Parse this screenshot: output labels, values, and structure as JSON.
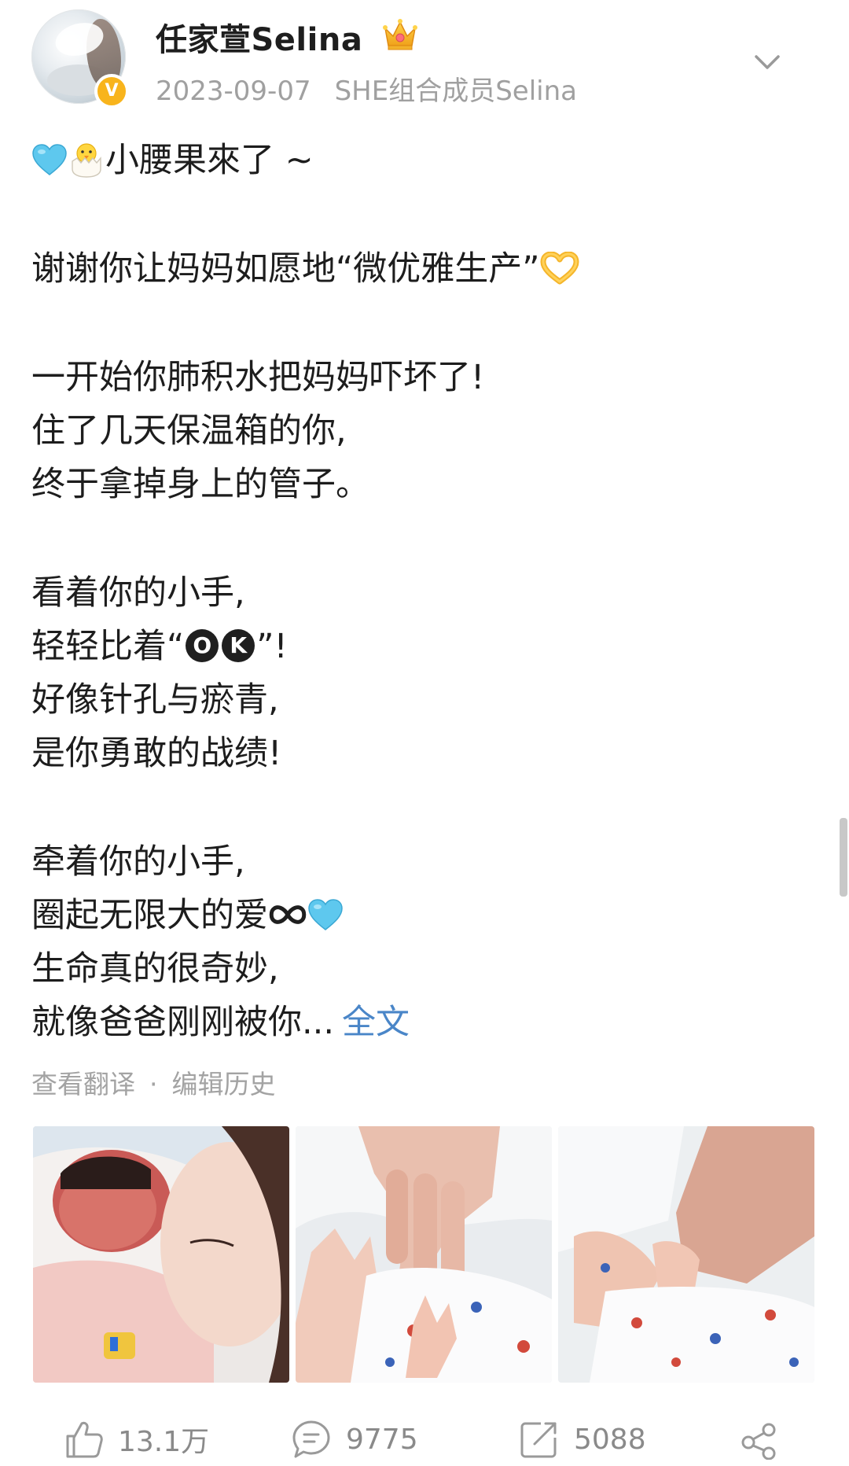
{
  "header": {
    "username": "任家萱Selina",
    "date": "2023-09-07",
    "source": "SHE组合成员Selina",
    "verified_mark": "V"
  },
  "post": {
    "line1_text": "小腰果來了 ~",
    "line2_text": "谢谢你让妈妈如愿地“微优雅生产”",
    "line3": "一开始你肺积水把妈妈吓坏了!",
    "line4": "住了几天保温箱的你,",
    "line5": "终于拿掉身上的管子。",
    "line6": "看着你的小手,",
    "line7_before": "轻轻比着“",
    "ok_letter_1": "O",
    "ok_letter_2": "K",
    "line7_after": "”!",
    "line8": "好像针孔与瘀青,",
    "line9": "是你勇敢的战绩!",
    "line10": "牵着你的小手,",
    "line11": "圈起无限大的爱",
    "line12": "生命真的很奇妙,",
    "line13": "就像爸爸刚刚被你...",
    "full_text_link": "全文"
  },
  "post_actions": {
    "translate": "查看翻译",
    "separator": "·",
    "edit_history": "编辑历史"
  },
  "toolbar": {
    "likes": "13.1万",
    "comments": "9775",
    "reposts": "5088"
  },
  "icons": {
    "line1_leading": [
      "blue-heart-icon",
      "hatching-chick-icon"
    ],
    "line2_trailing": "heart-hands-icon",
    "line11_trailing": [
      "infinity-icon",
      "blue-heart-icon"
    ],
    "toolbar": [
      "like-icon",
      "comment-icon",
      "repost-icon",
      "share-icon"
    ],
    "header": [
      "crown-icon",
      "chevron-down-icon"
    ]
  },
  "colors": {
    "link": "#4a86c8",
    "meta_gray": "#a0a0a0",
    "verified": "#f8b41c",
    "blue_heart": "#5ec8ee"
  }
}
